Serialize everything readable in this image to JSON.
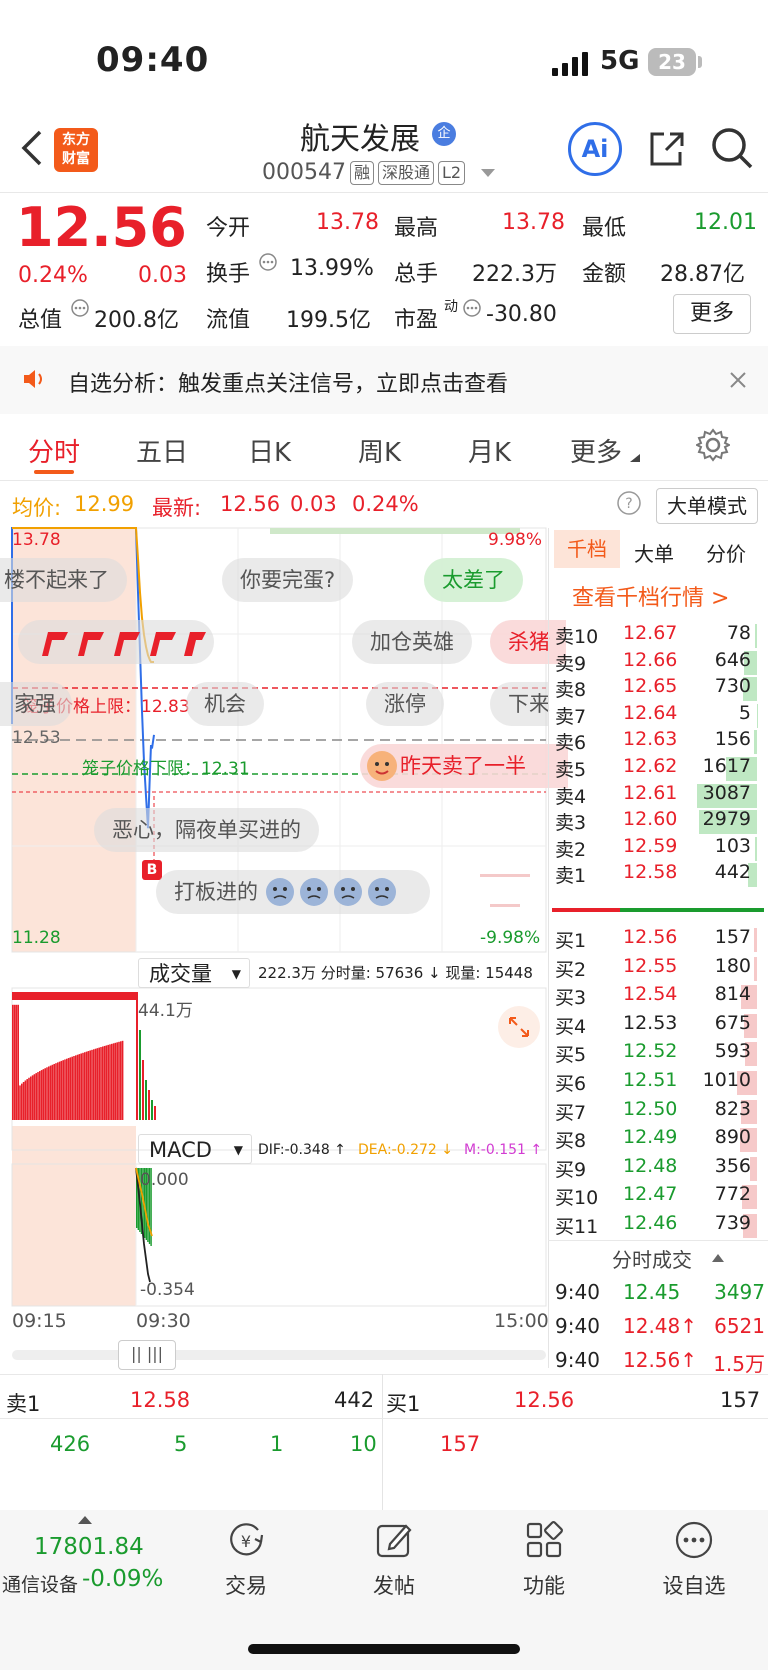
{
  "status": {
    "time": "09:40",
    "network": "5G",
    "battery": "23"
  },
  "header": {
    "logo_line1": "东方",
    "logo_line2": "财富",
    "name": "航天发展",
    "ent_badge": "企",
    "code": "000547",
    "tags": [
      "融",
      "深股通",
      "L2"
    ],
    "ai_label": "Ai"
  },
  "quote": {
    "price": "12.56",
    "pct": "0.24%",
    "chg": "0.03",
    "open_label": "今开",
    "open": "13.78",
    "high_label": "最高",
    "high": "13.78",
    "low_label": "最低",
    "low": "12.01",
    "turnover_label": "换手",
    "turnover": "13.99%",
    "vol_label": "总手",
    "vol": "222.3万",
    "amount_label": "金额",
    "amount": "28.87亿",
    "mcap_label": "总值",
    "mcap": "200.8亿",
    "float_label": "流值",
    "float": "199.5亿",
    "pe_label": "市盈",
    "pe_sup": "动",
    "pe": "-30.80",
    "more": "更多"
  },
  "notice": {
    "text": "自选分析：触发重点关注信号，立即点击查看"
  },
  "tabs": [
    "分时",
    "五日",
    "日K",
    "周K",
    "月K",
    "更多"
  ],
  "info_bar": {
    "avg_label": "均价:",
    "avg": "12.99",
    "latest_label": "最新:",
    "latest": "12.56",
    "chg": "0.03",
    "pct": "0.24%",
    "mode_button": "大单模式"
  },
  "chart": {
    "y_top": "13.78",
    "y_mid": "12.53",
    "y_bottom": "11.28",
    "pct_top": "9.98%",
    "pct_bottom": "-9.98%",
    "cage_upper": "笼子价格上限：12.83",
    "cage_lower": "笼子价格下限：12.31",
    "buy_marker": "B",
    "bubbles": [
      "楼不起来了",
      "你要完蛋?",
      "太差了",
      "加仓英雄",
      "杀猪",
      "家强",
      "机会",
      "涨停",
      "下来",
      "昨天卖了一半",
      "恶心，隔夜单买进的",
      "打板进的"
    ],
    "vol_label": "成交量",
    "vol_info": "222.3万 分时量: 57636 ↓ 现量: 15448",
    "vol_max": "44.1万",
    "macd_label": "MACD",
    "dif": "DIF:-0.348 ↑",
    "dea": "DEA:-0.272 ↓",
    "m": "M:-0.151 ↑",
    "macd_top": "0.000",
    "macd_bottom": "-0.354",
    "t_start": "09:15",
    "t_open": "09:30",
    "t_end": "15:00"
  },
  "chart_data": {
    "type": "line",
    "title": "分时",
    "x": [
      "09:15",
      "09:25",
      "09:30",
      "09:31",
      "09:32",
      "09:33",
      "09:34",
      "09:35",
      "09:36",
      "09:37",
      "09:38",
      "09:39",
      "09:40"
    ],
    "series": [
      {
        "name": "最新",
        "values": [
          13.78,
          13.78,
          13.78,
          13.4,
          13.05,
          12.7,
          12.4,
          12.2,
          12.01,
          12.35,
          12.5,
          12.48,
          12.56
        ]
      },
      {
        "name": "均价",
        "values": [
          13.78,
          13.78,
          13.78,
          13.6,
          13.4,
          13.25,
          13.15,
          13.08,
          13.03,
          13.0,
          12.99,
          12.99,
          12.99
        ]
      }
    ],
    "ylim": [
      11.28,
      13.78
    ],
    "volume_max": "44.1万"
  },
  "orderbook": {
    "tabs": [
      "千档",
      "大单",
      "分价"
    ],
    "link": "查看千档行情 >",
    "asks": [
      {
        "label": "卖10",
        "price": "12.67",
        "vol": "78"
      },
      {
        "label": "卖9",
        "price": "12.66",
        "vol": "646"
      },
      {
        "label": "卖8",
        "price": "12.65",
        "vol": "730"
      },
      {
        "label": "卖7",
        "price": "12.64",
        "vol": "5"
      },
      {
        "label": "卖6",
        "price": "12.63",
        "vol": "156"
      },
      {
        "label": "卖5",
        "price": "12.62",
        "vol": "1617"
      },
      {
        "label": "卖4",
        "price": "12.61",
        "vol": "3087"
      },
      {
        "label": "卖3",
        "price": "12.60",
        "vol": "2979"
      },
      {
        "label": "卖2",
        "price": "12.59",
        "vol": "103"
      },
      {
        "label": "卖1",
        "price": "12.58",
        "vol": "442"
      }
    ],
    "bids": [
      {
        "label": "买1",
        "price": "12.56",
        "vol": "157"
      },
      {
        "label": "买2",
        "price": "12.55",
        "vol": "180"
      },
      {
        "label": "买3",
        "price": "12.54",
        "vol": "814"
      },
      {
        "label": "买4",
        "price": "12.53",
        "vol": "675"
      },
      {
        "label": "买5",
        "price": "12.52",
        "vol": "593"
      },
      {
        "label": "买6",
        "price": "12.51",
        "vol": "1010"
      },
      {
        "label": "买7",
        "price": "12.50",
        "vol": "823"
      },
      {
        "label": "买8",
        "price": "12.49",
        "vol": "890"
      },
      {
        "label": "买9",
        "price": "12.48",
        "vol": "356"
      },
      {
        "label": "买10",
        "price": "12.47",
        "vol": "772"
      },
      {
        "label": "买11",
        "price": "12.46",
        "vol": "739"
      }
    ],
    "trades_title": "分时成交",
    "trades": [
      {
        "time": "9:40",
        "price": "12.45",
        "vol": "3497"
      },
      {
        "time": "9:40",
        "price": "12.48↑",
        "vol": "6521"
      },
      {
        "time": "9:40",
        "price": "12.56↑",
        "vol": "1.5万"
      }
    ]
  },
  "bottom_book": {
    "ask_label": "卖1",
    "ask_price": "12.58",
    "ask_vol": "442",
    "bid_label": "买1",
    "bid_price": "12.56",
    "bid_vol": "157",
    "ask_parts": [
      "426",
      "5",
      "1",
      "10"
    ],
    "bid_parts": [
      "157"
    ]
  },
  "bottom_nav": {
    "index_value": "17801.84",
    "index_name": "通信设备",
    "index_pct": "-0.09%",
    "items": [
      "交易",
      "发帖",
      "功能",
      "设自选"
    ]
  }
}
